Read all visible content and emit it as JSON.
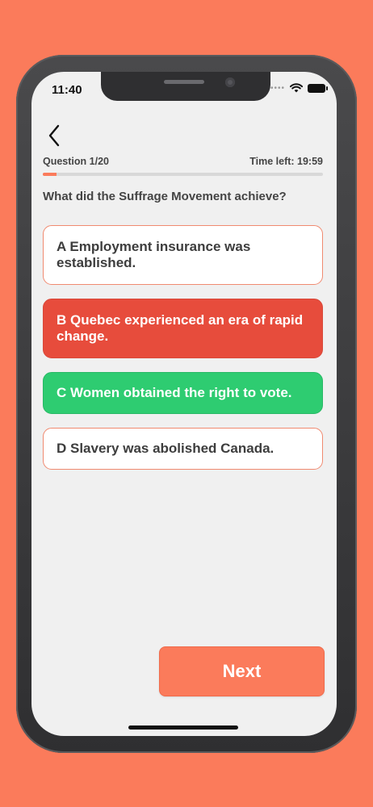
{
  "status_bar": {
    "time": "11:40"
  },
  "header": {
    "question_counter": "Question 1/20",
    "time_left": "Time left: 19:59",
    "progress_fraction": 0.05
  },
  "question": {
    "text": "What did the Suffrage Movement achieve?"
  },
  "options": [
    {
      "label": "A Employment insurance was established.",
      "state": "default"
    },
    {
      "label": "B Quebec experienced an era of rapid change.",
      "state": "wrong"
    },
    {
      "label": "C Women obtained the right to vote.",
      "state": "correct"
    },
    {
      "label": "D Slavery was abolished Canada.",
      "state": "default"
    }
  ],
  "footer": {
    "next_label": "Next"
  },
  "colors": {
    "accent": "#FB7B5B",
    "wrong": "#E74C3C",
    "correct": "#2ECC71",
    "screen_bg": "#F0F0F0"
  },
  "icons": {
    "back": "chevron-left-icon",
    "wifi": "wifi-icon",
    "battery": "battery-icon"
  }
}
